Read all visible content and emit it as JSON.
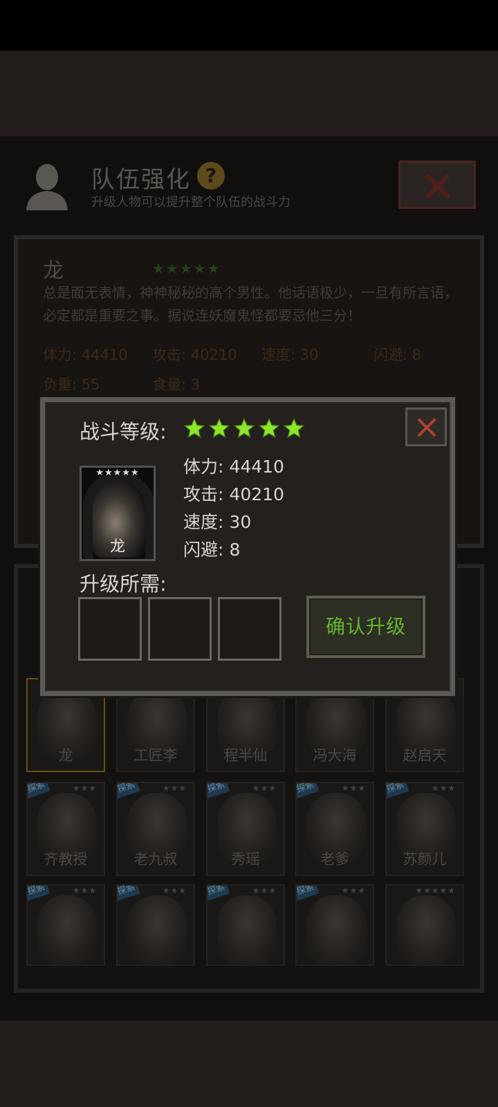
{
  "header": {
    "title": "队伍强化",
    "subtitle": "升级人物可以提升整个队伍的战斗力"
  },
  "info": {
    "name": "龙",
    "stars": "★★★★★",
    "description": "总是面无表情，神神秘秘的高个男性。他话语极少，一旦有所言语，必定都是重要之事。据说连妖魔鬼怪都要忌他三分！",
    "stats": [
      {
        "label": "体力: 44410"
      },
      {
        "label": "攻击: 40210"
      },
      {
        "label": "速度: 30"
      },
      {
        "label": "闪避: 8"
      },
      {
        "label": "负重: 55"
      },
      {
        "label": "食量: 3"
      }
    ]
  },
  "modal": {
    "title": "战斗等级:",
    "star_color": "#8ee62a",
    "star_count": 5,
    "portrait": {
      "stars": "★★★★★",
      "name": "龙"
    },
    "stats": [
      {
        "label": "体力:",
        "value": "44410"
      },
      {
        "label": "攻击:",
        "value": "40210"
      },
      {
        "label": "速度:",
        "value": "30"
      },
      {
        "label": "闪避:",
        "value": "8"
      }
    ],
    "requirement_label": "升级所需:",
    "confirm_label": "确认升级"
  },
  "characters": [
    {
      "name": "龙",
      "stars": "",
      "tag": ""
    },
    {
      "name": "工匠李",
      "stars": "",
      "tag": ""
    },
    {
      "name": "程半仙",
      "stars": "",
      "tag": ""
    },
    {
      "name": "冯大海",
      "stars": "",
      "tag": ""
    },
    {
      "name": "赵启天",
      "stars": "",
      "tag": ""
    },
    {
      "name": "齐教授",
      "stars": "★★★",
      "tag": "探索"
    },
    {
      "name": "老九叔",
      "stars": "★★★",
      "tag": "探索"
    },
    {
      "name": "秀瑶",
      "stars": "★★★",
      "tag": "探索"
    },
    {
      "name": "老爹",
      "stars": "★★★",
      "tag": "探索"
    },
    {
      "name": "苏颜儿",
      "stars": "★★★",
      "tag": "探索"
    },
    {
      "name": "",
      "stars": "★★★",
      "tag": "探索"
    },
    {
      "name": "",
      "stars": "★★★",
      "tag": "探索"
    },
    {
      "name": "",
      "stars": "★★★",
      "tag": "探索"
    },
    {
      "name": "",
      "stars": "★★★",
      "tag": "探索"
    },
    {
      "name": "",
      "stars": "★★★★★",
      "tag": ""
    }
  ]
}
